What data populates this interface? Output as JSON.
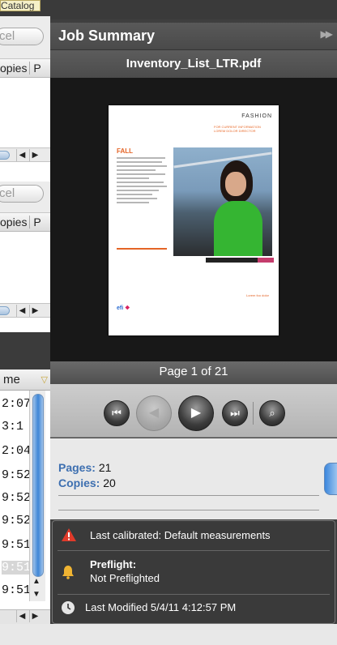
{
  "left_panel": {
    "catalog_label": "Catalog",
    "search_placeholder_1": "cel",
    "search_placeholder_2": "cel",
    "tab_copies_1": "opies",
    "tab_next_1": "P",
    "tab_copies_2": "opies",
    "tab_next_2": "P",
    "list_header": "me",
    "times": [
      "2:07:",
      "3:1",
      "2:04",
      "9:52",
      "9:52",
      "9:52",
      "9:51",
      "9:51",
      "9:51"
    ]
  },
  "job_summary": {
    "title": "Job Summary",
    "collapse_icon": "double-chevron-right-icon",
    "filename": "Inventory_List_LTR.pdf",
    "preview": {
      "header": "FASHION",
      "subheader": "FOR CURRENT INFORMATION LOREM DOLOR DIRECTOR",
      "section": "FALL",
      "logo_text": "efi",
      "note": "Lorem foo dolor"
    },
    "page_indicator": "Page 1 of 21",
    "pages_label": "Pages:",
    "pages_value": "21",
    "copies_label": "Copies:",
    "copies_value": "20",
    "alerts": [
      {
        "icon": "warning-icon",
        "text": "Last calibrated: Default measurements"
      },
      {
        "icon": "bell-icon",
        "title": "Preflight:",
        "text": "Not Preflighted"
      },
      {
        "icon": "clock-icon",
        "text": "Last Modified 5/4/11 4:12:57 PM"
      }
    ]
  },
  "colors": {
    "panel_bg": "#3f3f3f",
    "label_blue": "#3d6fb0",
    "warning_red": "#e03a2a",
    "bell_yellow": "#f0b432"
  }
}
